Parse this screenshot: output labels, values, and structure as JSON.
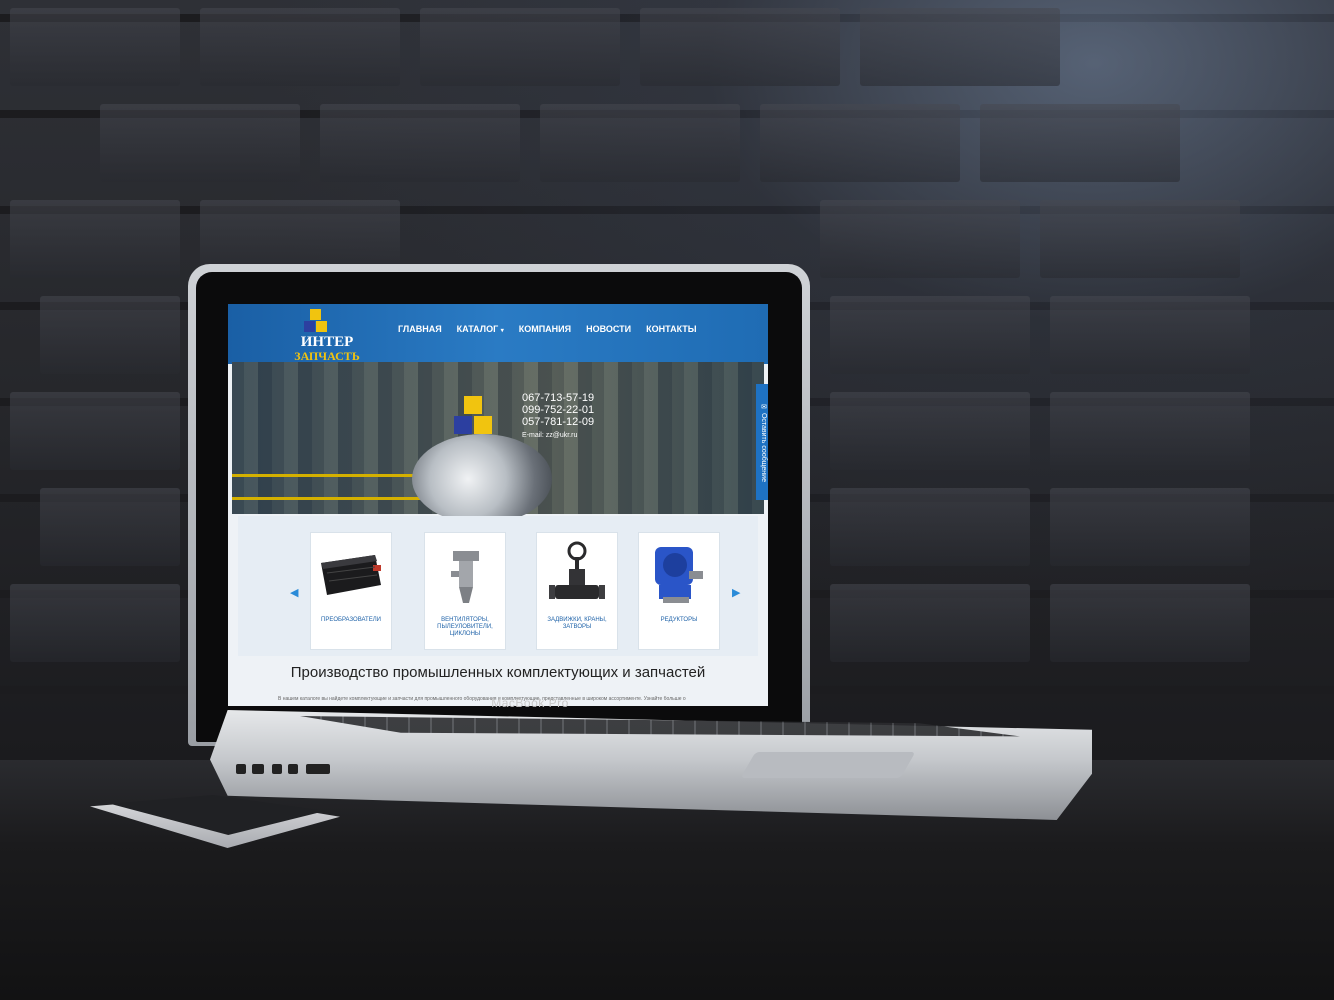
{
  "laptop": {
    "brand_label": "MacBook Pro"
  },
  "site": {
    "logo": {
      "line1": "ИНТЕР",
      "line2": "ЗАПЧАСТЬ",
      "icon": "cubes-logo-icon"
    },
    "nav": {
      "items": [
        {
          "label": "ГЛАВНАЯ"
        },
        {
          "label": "КАТАЛОГ",
          "icon": "chevron-down-icon"
        },
        {
          "label": "КОМПАНИЯ"
        },
        {
          "label": "НОВОСТИ"
        },
        {
          "label": "КОНТАКТЫ"
        }
      ]
    },
    "hero": {
      "phones": [
        "067-713-57-19",
        "099-752-22-01",
        "057-781-12-09"
      ],
      "email": "E-mail: zz@ukr.ru"
    },
    "feedback_tab": {
      "label": "Оставить сообщение",
      "icon": "chat-icon"
    },
    "carousel": {
      "prev_icon": "chevron-left-icon",
      "next_icon": "chevron-right-icon",
      "items": [
        {
          "label": "ПРЕОБРАЗОВАТЕЛИ",
          "icon": "inverter-icon"
        },
        {
          "label": "ВЕНТИЛЯТОРЫ, ПЫЛЕУЛОВИТЕЛИ, ЦИКЛОНЫ",
          "icon": "cyclone-icon"
        },
        {
          "label": "ЗАДВИЖКИ, КРАНЫ, ЗАТВОРЫ",
          "icon": "valve-icon"
        },
        {
          "label": "РЕДУКТОРЫ",
          "icon": "gearbox-icon"
        }
      ]
    },
    "headline": "Производство промышленных комплектующих и запчастей",
    "body_text": "В нашем каталоге вы найдете комплектующие и запчасти для промышленного оборудования и комплектующие, представленные в широком ассортименте. Узнайте больше о"
  },
  "colors": {
    "header_blue": "#2a7bc4",
    "logo_yellow": "#f1c40f",
    "link_blue": "#1e62a8"
  }
}
